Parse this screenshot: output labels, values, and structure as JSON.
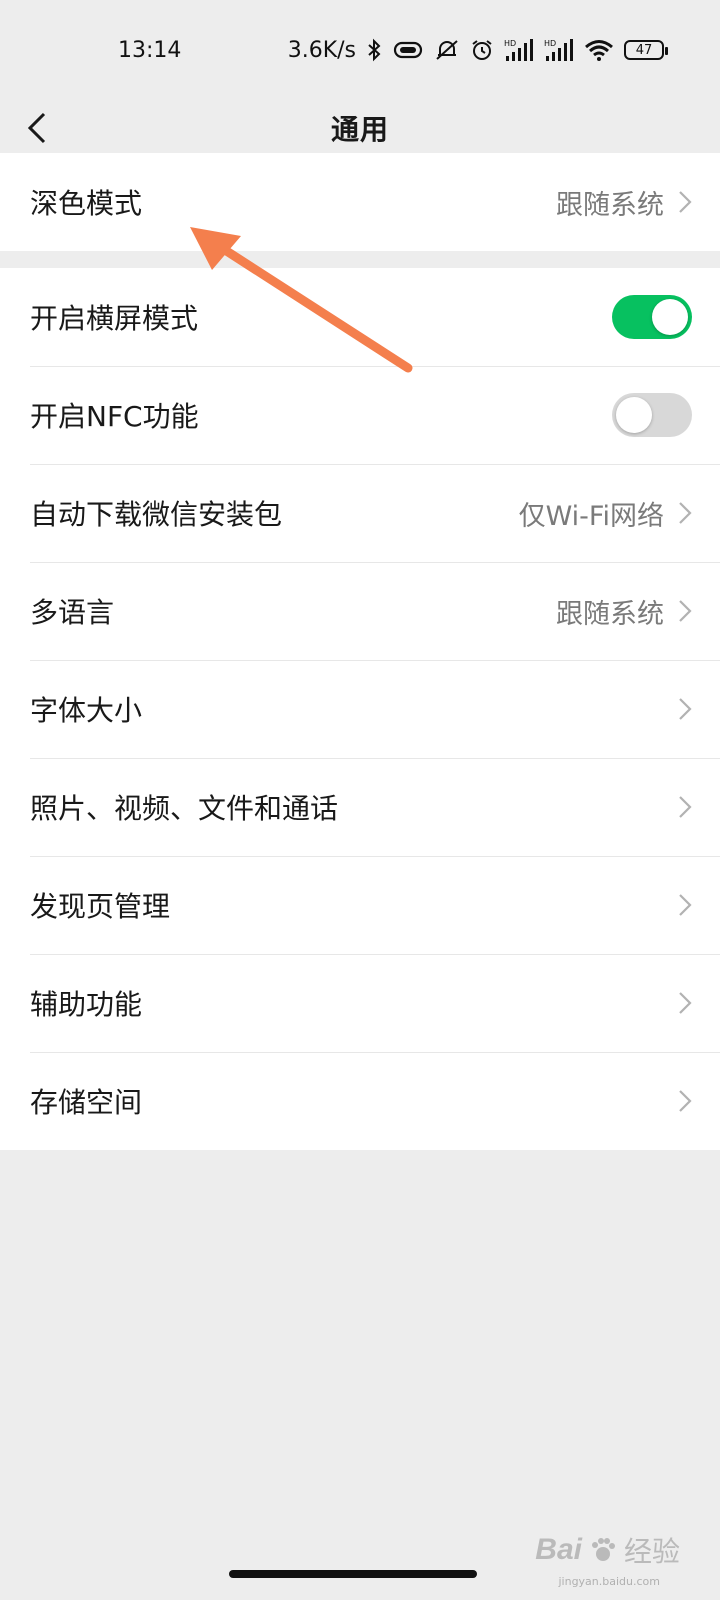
{
  "status_bar": {
    "time": "13:14",
    "speed": "3.6K/s",
    "battery": "47",
    "icons": [
      "bluetooth-icon",
      "vibrate-icon",
      "mute-icon",
      "alarm-icon",
      "signal-hd-icon",
      "signal-hd-icon",
      "wifi-icon",
      "battery-icon"
    ]
  },
  "nav": {
    "title": "通用",
    "back_icon": "chevron-left-icon"
  },
  "group1": {
    "dark_mode": {
      "label": "深色模式",
      "value": "跟随系统"
    }
  },
  "group2": {
    "landscape": {
      "label": "开启横屏模式",
      "toggle": "on"
    },
    "nfc": {
      "label": "开启NFC功能",
      "toggle": "off"
    },
    "auto_download": {
      "label": "自动下载微信安装包",
      "value": "仅Wi-Fi网络"
    },
    "language": {
      "label": "多语言",
      "value": "跟随系统"
    },
    "font_size": {
      "label": "字体大小"
    },
    "media": {
      "label": "照片、视频、文件和通话"
    },
    "discover": {
      "label": "发现页管理"
    },
    "accessibility": {
      "label": "辅助功能"
    },
    "storage": {
      "label": "存储空间"
    }
  },
  "colors": {
    "toggle_on": "#07c160",
    "toggle_off": "#d8d8d8",
    "annotation_arrow": "#f47f4d"
  },
  "watermark": {
    "brand": "Bai",
    "sub": "经验",
    "url": "jingyan.baidu.com"
  }
}
